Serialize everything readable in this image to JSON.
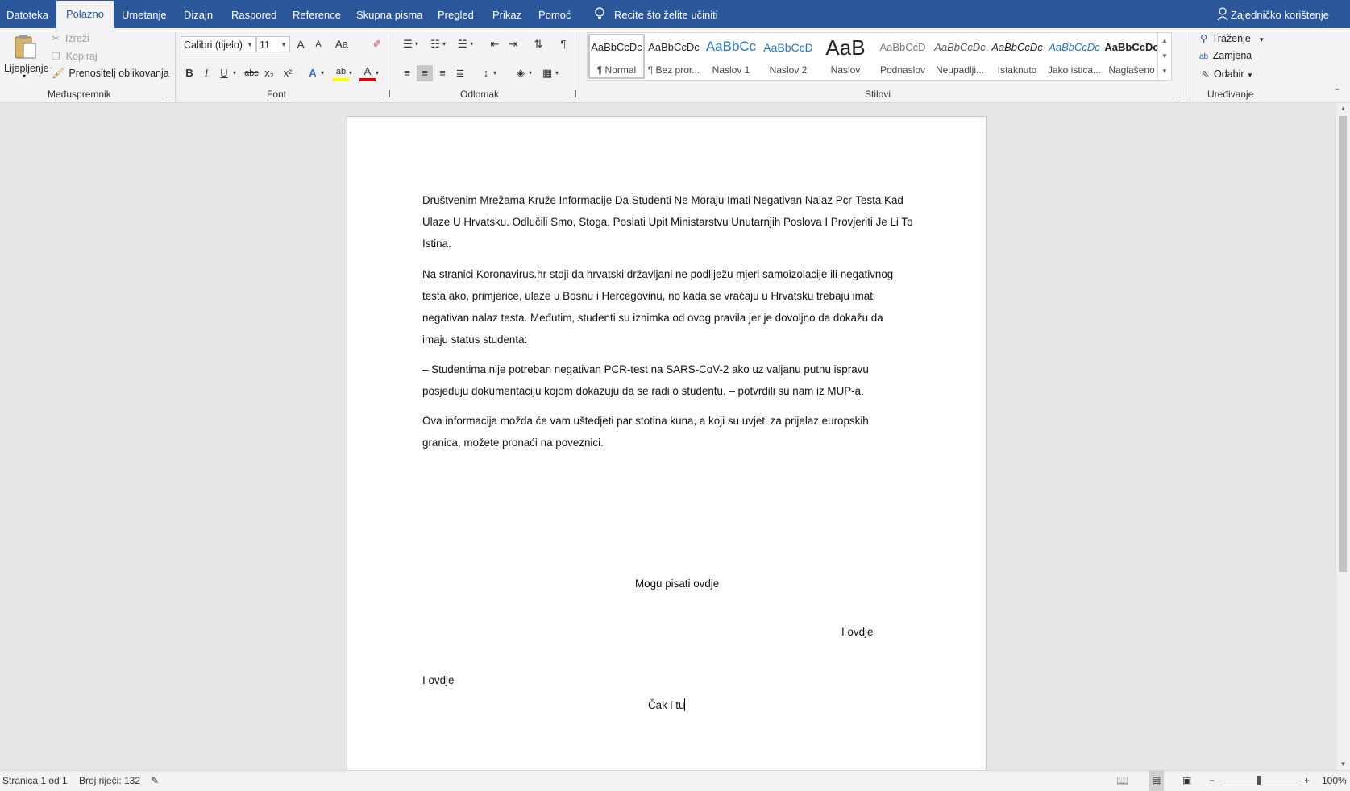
{
  "tabs": [
    {
      "label": "Datoteka"
    },
    {
      "label": "Polazno"
    },
    {
      "label": "Umetanje"
    },
    {
      "label": "Dizajn"
    },
    {
      "label": "Raspored"
    },
    {
      "label": "Reference"
    },
    {
      "label": "Skupna pisma"
    },
    {
      "label": "Pregled"
    },
    {
      "label": "Prikaz"
    },
    {
      "label": "Pomoć"
    }
  ],
  "tell_me": "Recite što želite učiniti",
  "share": "Zajedničko korištenje",
  "colors": {
    "brand": "#2b579a",
    "ribbon_bg": "#f3f3f3",
    "highlight_yellow": "#ffff00",
    "font_color_red": "#e00000"
  },
  "clipboard": {
    "paste": "Lijepljenje",
    "cut": "Izreži",
    "copy": "Kopiraj",
    "format_painter": "Prenositelj oblikovanja",
    "label": "Međuspremnik"
  },
  "font": {
    "name": "Calibri (tijelo)",
    "size": "11",
    "label": "Font",
    "grow": "A",
    "shrink": "A",
    "case": "Aa",
    "bold": "B",
    "italic": "I",
    "underline": "U",
    "strike": "abc",
    "subscript": "x₂",
    "superscript": "x²",
    "effects": "A",
    "highlight": "ab",
    "color": "A"
  },
  "paragraph": {
    "label": "Odlomak"
  },
  "styles": {
    "label": "Stilovi",
    "items": [
      {
        "sample": "AaBbCcDc",
        "name": "¶ Normal"
      },
      {
        "sample": "AaBbCcDc",
        "name": "¶ Bez pror..."
      },
      {
        "sample": "AaBbCc",
        "name": "Naslov 1"
      },
      {
        "sample": "AaBbCcD",
        "name": "Naslov 2"
      },
      {
        "sample": "AaB",
        "name": "Naslov"
      },
      {
        "sample": "AaBbCcD",
        "name": "Podnaslov"
      },
      {
        "sample": "AaBbCcDc",
        "name": "Neupadlji..."
      },
      {
        "sample": "AaBbCcDc",
        "name": "Istaknuto"
      },
      {
        "sample": "AaBbCcDc",
        "name": "Jako istica..."
      },
      {
        "sample": "AaBbCcDc",
        "name": "Naglašeno"
      }
    ]
  },
  "editing": {
    "find": "Traženje",
    "replace": "Zamjena",
    "select": "Odabir",
    "label": "Uređivanje"
  },
  "document": {
    "paragraphs": [
      [
        "Društvenim Mrežama Kruže Informacije Da Studenti Ne Moraju Imati Negativan Nalaz Pcr-Testa Kad",
        "Ulaze U Hrvatsku. Odlučili Smo, Stoga, Poslati Upit Ministarstvu Unutarnjih Poslova I Provjeriti Je Li To",
        "Istina."
      ],
      [
        "Na stranici Koronavirus.hr stoji da hrvatski državljani ne podliježu mjeri samoizolacije ili negativnog",
        "testa ako, primjerice, ulaze u Bosnu i Hercegovinu, no kada se vraćaju u Hrvatsku trebaju imati",
        "negativan nalaz testa. Međutim, studenti su iznimka od ovog pravila jer je dovoljno da dokažu da",
        "imaju status studenta:"
      ],
      [
        "– Studentima nije potreban negativan PCR-test na SARS-CoV-2 ako uz valjanu putnu ispravu",
        "posjeduju dokumentaciju kojom dokazuju da se radi o studentu. – potvrdili su nam iz MUP-a."
      ],
      [
        "Ova informacija možda će vam uštedjeti par stotina kuna, a koji su uvjeti za prijelaz europskih",
        "granica, možete pronaći na poveznici."
      ]
    ],
    "free_text": [
      "Mogu pisati ovdje",
      "I ovdje",
      "I ovdje",
      "Čak i tu"
    ]
  },
  "status": {
    "page": "Stranica 1 od 1",
    "words": "Broj riječi: 132",
    "zoom": "100%"
  }
}
